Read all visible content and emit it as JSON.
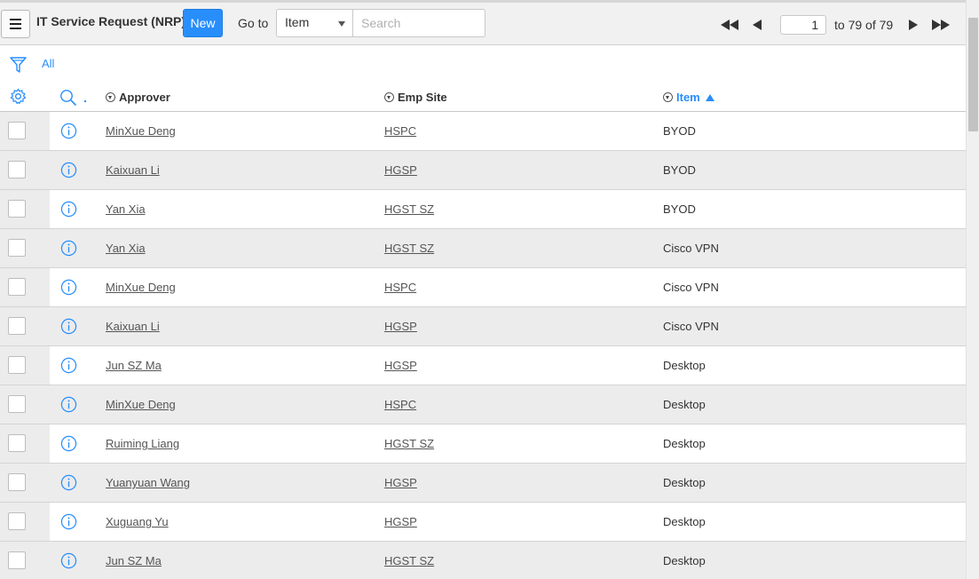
{
  "header": {
    "title": "IT Service Request (NRP)",
    "new_label": "New",
    "goto_label": "Go to",
    "goto_selected": "Item",
    "search_placeholder": "Search",
    "page_current": "1",
    "page_total": "to 79 of 79"
  },
  "filter": {
    "label": "All"
  },
  "columns": {
    "approver": "Approver",
    "emp_site": "Emp Site",
    "item": "Item"
  },
  "colors": {
    "accent": "#278efc",
    "row_alt": "#ececec"
  },
  "rows": [
    {
      "approver": "MinXue Deng",
      "emp_site": "HSPC",
      "item": "BYOD"
    },
    {
      "approver": "Kaixuan Li",
      "emp_site": "HGSP",
      "item": "BYOD"
    },
    {
      "approver": "Yan Xia",
      "emp_site": "HGST SZ",
      "item": "BYOD"
    },
    {
      "approver": "Yan Xia",
      "emp_site": "HGST SZ",
      "item": "Cisco VPN"
    },
    {
      "approver": "MinXue Deng",
      "emp_site": "HSPC",
      "item": "Cisco VPN"
    },
    {
      "approver": "Kaixuan Li",
      "emp_site": "HGSP",
      "item": "Cisco VPN"
    },
    {
      "approver": "Jun SZ Ma",
      "emp_site": "HGSP",
      "item": "Desktop"
    },
    {
      "approver": "MinXue Deng",
      "emp_site": "HSPC",
      "item": "Desktop"
    },
    {
      "approver": "Ruiming Liang",
      "emp_site": "HGST SZ",
      "item": "Desktop"
    },
    {
      "approver": "Yuanyuan Wang",
      "emp_site": "HGSP",
      "item": "Desktop"
    },
    {
      "approver": "Xuguang Yu",
      "emp_site": "HGSP",
      "item": "Desktop"
    },
    {
      "approver": "Jun SZ Ma",
      "emp_site": "HGST SZ",
      "item": "Desktop"
    }
  ]
}
